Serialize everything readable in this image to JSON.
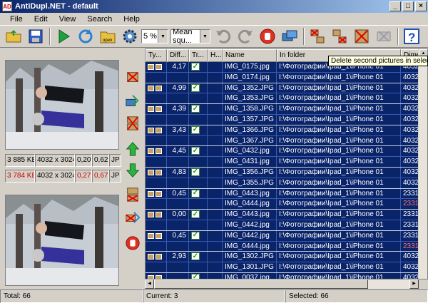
{
  "window": {
    "title": "AntiDupl.NET - default",
    "app_icon_text": "AD"
  },
  "menu": [
    "File",
    "Edit",
    "View",
    "Search",
    "Help"
  ],
  "toolbar": {
    "threshold_value": "5 %",
    "compare_mode": "Mean squ..."
  },
  "preview": {
    "first": {
      "size": "3 885 KB",
      "resolution": "4032 x 3024",
      "blockiness": "0,20",
      "blurring": "0,62",
      "type": "JP"
    },
    "second": {
      "size": "3 784 KB",
      "resolution": "4032 x 3024",
      "blockiness": "0,27",
      "blurring": "0,67",
      "type": "JP"
    }
  },
  "table": {
    "headers": [
      "Ty...",
      "Diff...",
      "Tr...",
      "H...",
      "Name",
      "In folder",
      "Dime"
    ],
    "groups": [
      {
        "diff": "4,17",
        "rows": [
          {
            "name": "IMG_0175.jpg",
            "folder": "I:\\Фотографии\\Ipad_1\\iPhone 01",
            "dim": "4032"
          },
          {
            "name": "IMG_0174.jpg",
            "folder": "I:\\Фотографии\\Ipad_1\\iPhone 01",
            "dim": "4032"
          }
        ]
      },
      {
        "diff": "4,99",
        "rows": [
          {
            "name": "IMG_1352.JPG",
            "folder": "I:\\Фотографии\\Ipad_1\\iPhone 01",
            "dim": "4032"
          },
          {
            "name": "IMG_1353.JPG",
            "folder": "I:\\Фотографии\\Ipad_1\\iPhone 01",
            "dim": "4032"
          }
        ]
      },
      {
        "diff": "4,39",
        "rows": [
          {
            "name": "IMG_1358.JPG",
            "folder": "I:\\Фотографии\\Ipad_1\\iPhone 01",
            "dim": "4032"
          },
          {
            "name": "IMG_1357.JPG",
            "folder": "I:\\Фотографии\\Ipad_1\\iPhone 01",
            "dim": "4032"
          }
        ]
      },
      {
        "diff": "3,43",
        "rows": [
          {
            "name": "IMG_1366.JPG",
            "folder": "I:\\Фотографии\\Ipad_1\\iPhone 01",
            "dim": "4032"
          },
          {
            "name": "IMG_1367.JPG",
            "folder": "I:\\Фотографии\\Ipad_1\\iPhone 01",
            "dim": "4032"
          }
        ]
      },
      {
        "diff": "4,45",
        "rows": [
          {
            "name": "IMG_0432.jpg",
            "folder": "I:\\Фотографии\\Ipad_1\\iPhone 01",
            "dim": "4032"
          },
          {
            "name": "IMG_0431.jpg",
            "folder": "I:\\Фотографии\\Ipad_1\\iPhone 01",
            "dim": "4032"
          }
        ]
      },
      {
        "diff": "4,83",
        "rows": [
          {
            "name": "IMG_1356.JPG",
            "folder": "I:\\Фотографии\\Ipad_1\\iPhone 01",
            "dim": "4032"
          },
          {
            "name": "IMG_1355.JPG",
            "folder": "I:\\Фотографии\\Ipad_1\\iPhone 01",
            "dim": "4032"
          }
        ]
      },
      {
        "diff": "0,45",
        "rows": [
          {
            "name": "IMG_0443.jpg",
            "folder": "I:\\Фотографии\\Ipad_1\\iPhone 01",
            "dim": "2331"
          },
          {
            "name": "IMG_0444.jpg",
            "folder": "I:\\Фотографии\\Ipad_1\\iPhone 01",
            "dim": "2331",
            "dim_red": true
          }
        ]
      },
      {
        "diff": "0,00",
        "rows": [
          {
            "name": "IMG_0443.jpg",
            "folder": "I:\\Фотографии\\Ipad_1\\iPhone 01",
            "dim": "2331"
          },
          {
            "name": "IMG_0442.jpg",
            "folder": "I:\\Фотографии\\Ipad_1\\iPhone 01",
            "dim": "2331"
          }
        ]
      },
      {
        "diff": "0,45",
        "rows": [
          {
            "name": "IMG_0442.jpg",
            "folder": "I:\\Фотографии\\Ipad_1\\iPhone 01",
            "dim": "2331"
          },
          {
            "name": "IMG_0444.jpg",
            "folder": "I:\\Фотографии\\Ipad_1\\iPhone 01",
            "dim": "2331",
            "dim_red": true
          }
        ]
      },
      {
        "diff": "2,93",
        "rows": [
          {
            "name": "IMG_1302.JPG",
            "folder": "I:\\Фотографии\\Ipad_1\\iPhone 01",
            "dim": "4032"
          },
          {
            "name": "IMG_1301.JPG",
            "folder": "I:\\Фотографии\\Ipad_1\\iPhone 01",
            "dim": "4032"
          }
        ]
      },
      {
        "diff": "",
        "rows": [
          {
            "name": "IMG_0037.jpg",
            "folder": "I:\\Фотографии\\Ipad_1\\iPhone 01",
            "dim": "4032"
          }
        ]
      }
    ]
  },
  "tooltip": "Delete second pictures in selected res",
  "status": {
    "total": "Total: 66",
    "current": "Current: 3",
    "selected": "Selected: 66"
  },
  "colors": {
    "selection": "#0a246a",
    "accent_red": "#d00000"
  }
}
